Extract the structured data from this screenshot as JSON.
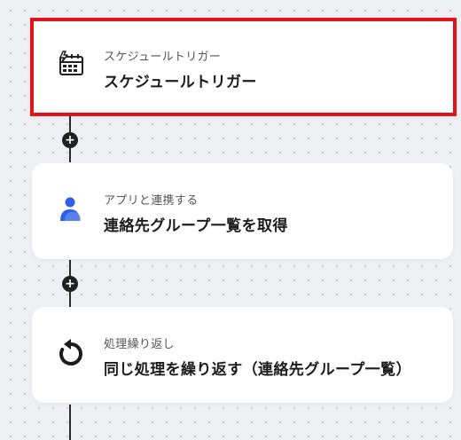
{
  "steps": [
    {
      "subtitle": "スケジュールトリガー",
      "title": "スケジュールトリガー",
      "icon": "schedule-trigger-icon",
      "selected": true
    },
    {
      "subtitle": "アプリと連携する",
      "title": "連絡先グループ一覧を取得",
      "icon": "person-icon",
      "accent": "#2f5ee8"
    },
    {
      "subtitle": "処理繰り返し",
      "title": "同じ処理を繰り返す（連絡先グループ一覧）",
      "icon": "loop-icon"
    }
  ],
  "connectors": [
    {
      "symbol": "+"
    },
    {
      "symbol": "+"
    }
  ],
  "colors": {
    "selected_border": "#e1141b",
    "connector": "#202020",
    "canvas": "#eff0f4"
  }
}
